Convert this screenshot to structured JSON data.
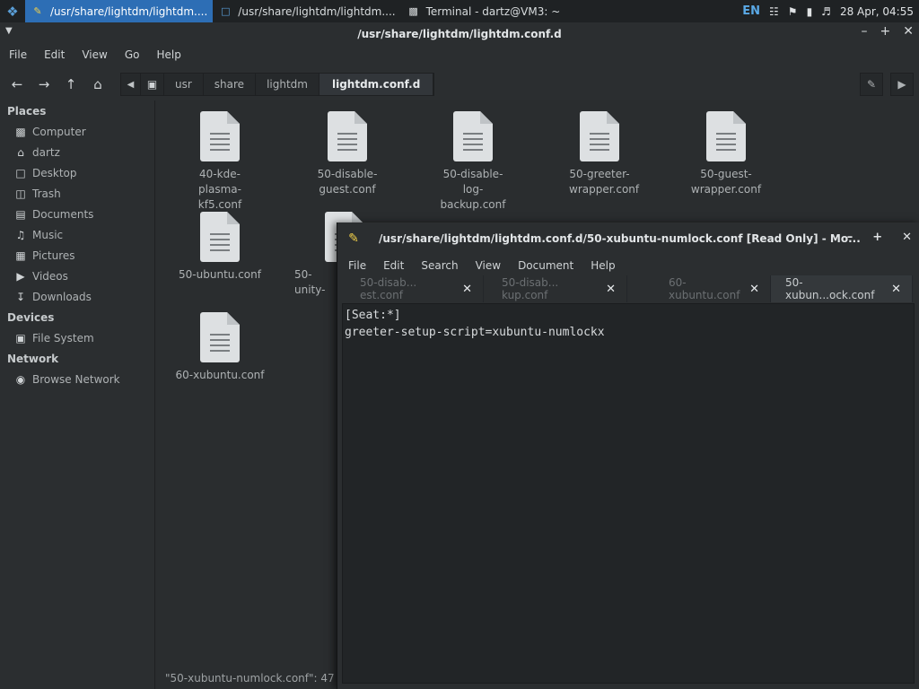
{
  "panel": {
    "logo_icon": "xfce-mouse-icon",
    "tasks": [
      {
        "label": "/usr/share/lightdm/lightdm....",
        "icon": "text-editor-icon",
        "active": true
      },
      {
        "label": "/usr/share/lightdm/lightdm....",
        "icon": "folder-icon",
        "active": false
      },
      {
        "label": "Terminal - dartz@VM3: ~",
        "icon": "terminal-icon",
        "active": false
      }
    ],
    "tray": {
      "lang": "EN",
      "datetime": "28 Apr, 04:55"
    }
  },
  "file_manager": {
    "title": "/usr/share/lightdm/lightdm.conf.d",
    "menu": [
      "File",
      "Edit",
      "View",
      "Go",
      "Help"
    ],
    "path": [
      "usr",
      "share",
      "lightdm",
      "lightdm.conf.d"
    ],
    "sidebar": {
      "places_header": "Places",
      "places": [
        "Computer",
        "dartz",
        "Desktop",
        "Trash",
        "Documents",
        "Music",
        "Pictures",
        "Videos",
        "Downloads"
      ],
      "devices_header": "Devices",
      "devices": [
        "File System"
      ],
      "network_header": "Network",
      "network": [
        "Browse Network"
      ]
    },
    "files": [
      "40-kde-plasma-kf5.conf",
      "50-disable-guest.conf",
      "50-disable-log-backup.conf",
      "50-greeter-wrapper.conf",
      "50-guest-wrapper.conf",
      "50-ubuntu.conf",
      "50-unity-",
      "60-xubuntu.conf"
    ],
    "status": "\"50-xubuntu-numlock.conf\": 47 by"
  },
  "editor": {
    "title": "/usr/share/lightdm/lightdm.conf.d/50-xubuntu-numlock.conf [Read Only] - Mo...",
    "menu": [
      "File",
      "Edit",
      "Search",
      "View",
      "Document",
      "Help"
    ],
    "tabs": [
      {
        "label": "50-disab... est.conf",
        "active": false
      },
      {
        "label": "50-disab... kup.conf",
        "active": false
      },
      {
        "label": "60-xubuntu.conf",
        "active": false
      },
      {
        "label": "50-xubun...ock.conf",
        "active": true
      }
    ],
    "content": [
      "[Seat:*]",
      "greeter-setup-script=xubuntu-numlockx"
    ]
  }
}
